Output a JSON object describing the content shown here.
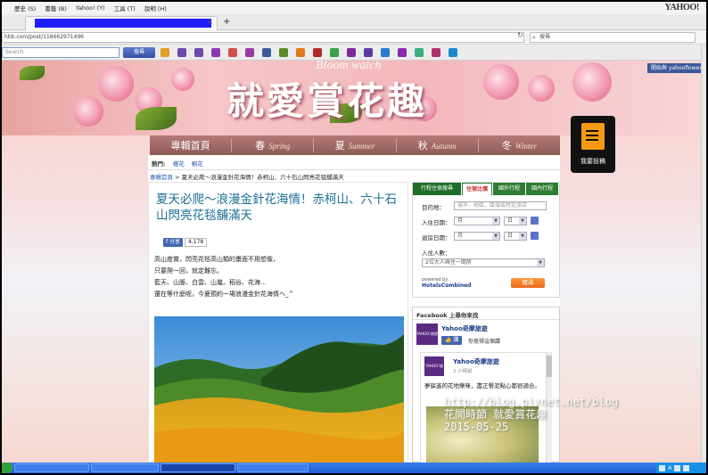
{
  "browser": {
    "menu": [
      "歷史 (S)",
      "書籤 (B)",
      "Yahoo! (Y)",
      "工具 (T)",
      "說明 (H)"
    ],
    "brand": "YAHOO!",
    "tab_close": "×",
    "tab_new": "+",
    "url": "hbb.com/post/118662971496",
    "search_placeholder": "搜尋",
    "toolbar_search_placeholder": "Search",
    "toolbar_search_button": "搜尋"
  },
  "site": {
    "title": "就愛賞花趣",
    "subtitle": "Bloom watch",
    "nav": [
      {
        "label": "專輯首頁",
        "en": ""
      },
      {
        "label": "春",
        "en": "Spring"
      },
      {
        "label": "夏",
        "en": "Summer"
      },
      {
        "label": "秋",
        "en": "Autumn"
      },
      {
        "label": "冬",
        "en": "Winter"
      }
    ],
    "submit_label": "我要投稿",
    "fb_widget": "開始與 yahooflowerto"
  },
  "hot": {
    "label": "熱門:",
    "links": [
      "櫻花",
      "桐花"
    ]
  },
  "breadcrumb": {
    "home": "專輯首頁",
    "sep": " > ",
    "current": "夏天必爬～浪漫金針花海情！赤柯山、六十石山閃亮花毯舖滿天"
  },
  "article": {
    "title": "夏天必爬～浪漫金針花海情！赤柯山、六十石山閃亮花毯舖滿天",
    "share_label": "分享",
    "share_count": "4,178",
    "body": [
      "高山度賞，閃亮花毯高山類的畫面不用想像，",
      "只要爬一回，就定難忘。",
      "藍天、山脈、白雲、山嵐、稻谷、花海...",
      "還在等什麼呢，今夏預約一場浪漫金針花海情へ_^"
    ]
  },
  "booking": {
    "tabs": [
      "行程住宿搜尋",
      "住宿比價",
      "國外行程",
      "國內行程"
    ],
    "destination_label": "目的地：",
    "destination_placeholder": "城市、地區、區域或特定旅店",
    "checkin_label": "入住日期：",
    "checkout_label": "退房日期：",
    "month": "月",
    "day": "日",
    "guests_label": "入住人數：",
    "guests_value": "2位大人與住一間房",
    "powered": "powered by",
    "provider": "HotelsCombined",
    "search_button": "搜尋"
  },
  "facebook": {
    "box_title": "Facebook 上尋你來找",
    "page_name": "Yahoo奇摩旅遊",
    "avatar_text": "YAHOO!旅遊",
    "like": "讚",
    "like_text": "你覺得這個讚",
    "post_time": "2 小時前",
    "post_text": "夢寐遙的花地樂咪，盡正餐泥點心都很適合。"
  },
  "watermark": {
    "line1": "http://blog.pixnet.net/blog",
    "line2": "花開時節 就愛賞花趣",
    "line3": "2015-05-25"
  },
  "colors": {
    "title_blue": "#1d6f96",
    "nav_brown": "#8e5a58",
    "link_blue": "#2a5db0",
    "booking_green": "#2f7c33"
  }
}
